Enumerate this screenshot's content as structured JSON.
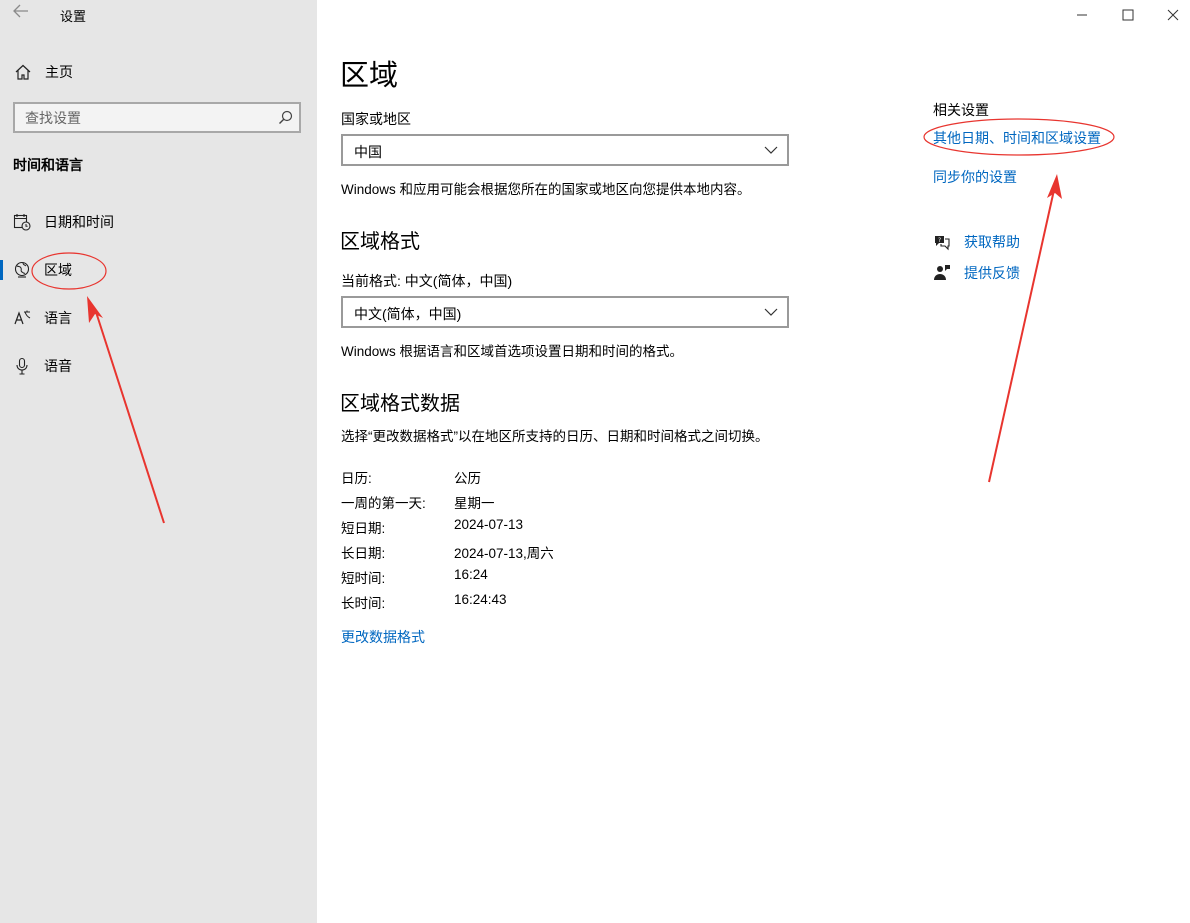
{
  "window": {
    "app_title": "设置"
  },
  "sidebar": {
    "home_label": "主页",
    "search_placeholder": "查找设置",
    "section_title": "时间和语言",
    "items": [
      {
        "label": "日期和时间",
        "icon": "calendar-clock-icon"
      },
      {
        "label": "区域",
        "icon": "globe-icon",
        "selected": true
      },
      {
        "label": "语言",
        "icon": "language-icon"
      },
      {
        "label": "语音",
        "icon": "microphone-icon"
      }
    ]
  },
  "main": {
    "title": "区域",
    "country_label": "国家或地区",
    "country_value": "中国",
    "country_desc": "Windows 和应用可能会根据您所在的国家或地区向您提供本地内容。",
    "format_heading": "区域格式",
    "current_format_label": "当前格式: 中文(简体，中国)",
    "format_value": "中文(简体，中国)",
    "format_desc": "Windows 根据语言和区域首选项设置日期和时间的格式。",
    "data_heading": "区域格式数据",
    "data_desc": "选择“更改数据格式”以在地区所支持的日历、日期和时间格式之间切换。",
    "data_rows": [
      {
        "key": "日历:",
        "value": "公历"
      },
      {
        "key": "一周的第一天:",
        "value": "星期一"
      },
      {
        "key": "短日期:",
        "value": "2024-07-13"
      },
      {
        "key": "长日期:",
        "value": "2024-07-13,周六"
      },
      {
        "key": "短时间:",
        "value": "16:24"
      },
      {
        "key": "长时间:",
        "value": "16:24:43"
      }
    ],
    "change_format_link": "更改数据格式"
  },
  "related": {
    "title": "相关设置",
    "link_other": "其他日期、时间和区域设置",
    "link_sync": "同步你的设置",
    "help": "获取帮助",
    "feedback": "提供反馈"
  },
  "colors": {
    "accent": "#0067c0",
    "annotation": "#e8352f",
    "sidebar_bg": "#e6e6e6"
  }
}
